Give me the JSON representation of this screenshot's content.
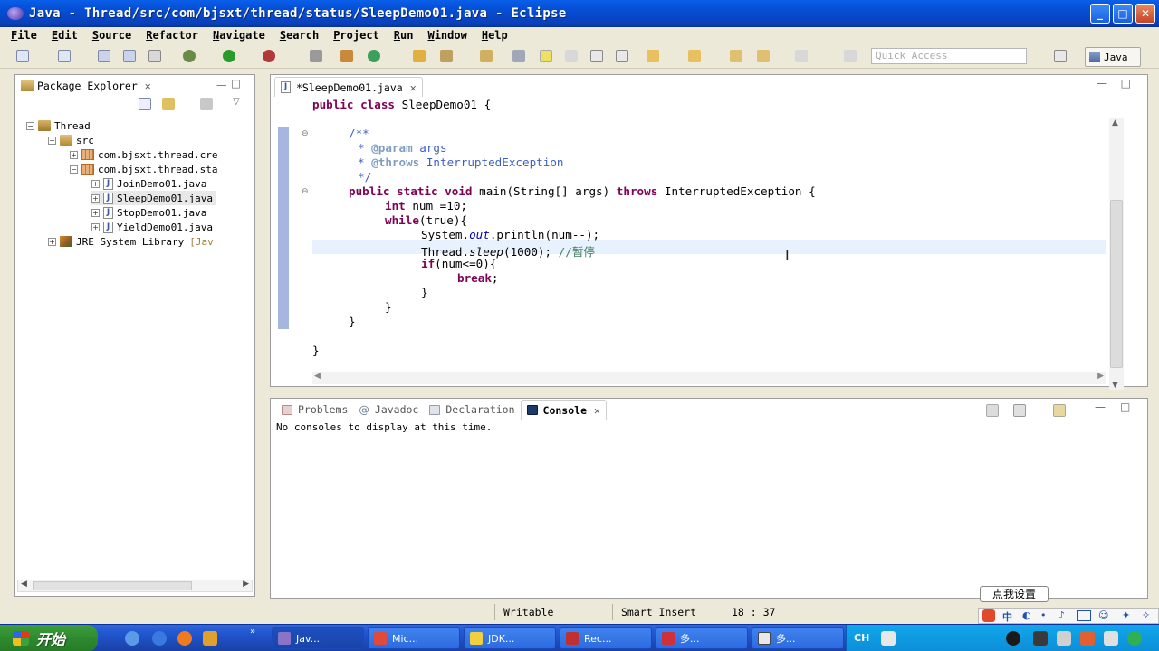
{
  "window": {
    "title": "Java - Thread/src/com/bjsxt/thread/status/SleepDemo01.java - Eclipse"
  },
  "menu": [
    "File",
    "Edit",
    "Source",
    "Refactor",
    "Navigate",
    "Search",
    "Project",
    "Run",
    "Window",
    "Help"
  ],
  "toolbar": {
    "quick_access_placeholder": "Quick Access",
    "perspective": "Java"
  },
  "package_explorer": {
    "title": "Package Explorer",
    "tree": [
      {
        "label": "Thread",
        "level": 0,
        "expander": "−",
        "icon": "project-icon"
      },
      {
        "label": "src",
        "level": 1,
        "expander": "−",
        "icon": "source-folder-icon"
      },
      {
        "label": "com.bjsxt.thread.cre",
        "level": 2,
        "expander": "+",
        "icon": "package-icon"
      },
      {
        "label": "com.bjsxt.thread.sta",
        "level": 2,
        "expander": "−",
        "icon": "package-icon"
      },
      {
        "label": "JoinDemo01.java",
        "level": 3,
        "expander": "+",
        "icon": "java-file-icon"
      },
      {
        "label": "SleepDemo01.java",
        "level": 3,
        "expander": "+",
        "icon": "java-file-icon",
        "selected": true
      },
      {
        "label": "StopDemo01.java",
        "level": 3,
        "expander": "+",
        "icon": "java-file-icon"
      },
      {
        "label": "YieldDemo01.java",
        "level": 3,
        "expander": "+",
        "icon": "java-file-icon"
      },
      {
        "label": "JRE System Library",
        "suffix": "[Jav",
        "level": 0,
        "expander": "+",
        "icon": "library-icon"
      }
    ]
  },
  "editor": {
    "tab_label": "*SleepDemo01.java",
    "code": {
      "class_decl": "SleepDemo01 {",
      "javadoc_open": "/**",
      "javadoc_param_tag": "@param",
      "javadoc_param_name": "args",
      "javadoc_throws_tag": "@throws",
      "javadoc_throws_name": "InterruptedException",
      "javadoc_close": "*/",
      "main_sig": "main(String[] args)",
      "main_throws": "InterruptedException {",
      "int_decl": "num =10;",
      "while_cond": "(true){",
      "println_a": "System.",
      "println_field": "out",
      "println_b": ".println(num--);",
      "sleep_a": "Thread.",
      "sleep_method": "sleep",
      "sleep_b": "(1000); ",
      "sleep_comment": "//暂停",
      "if_cond": "(num<=0){",
      "brk": ";",
      "close_brace": "}"
    }
  },
  "bottom_panel": {
    "tabs": [
      "Problems",
      "Javadoc",
      "Declaration",
      "Console"
    ],
    "active_tab": "Console",
    "message": "No consoles to display at this time."
  },
  "status_bar": {
    "writable": "Writable",
    "insert_mode": "Smart Insert",
    "position": "18 : 37"
  },
  "ime_tooltip": "点我设置",
  "taskbar": {
    "start_label": "开始",
    "tasks": [
      "Jav...",
      "Mic...",
      "JDK...",
      "Rec...",
      "多...",
      "多..."
    ],
    "tray_lang": "CH"
  },
  "colors": {
    "keyword": "#7F0055",
    "comment": "#3F5FBF",
    "line_comment": "#3F7F5F",
    "title_bar": "#0A5FE8",
    "taskbar": "#2257D1",
    "start_button": "#3C9F3C"
  }
}
